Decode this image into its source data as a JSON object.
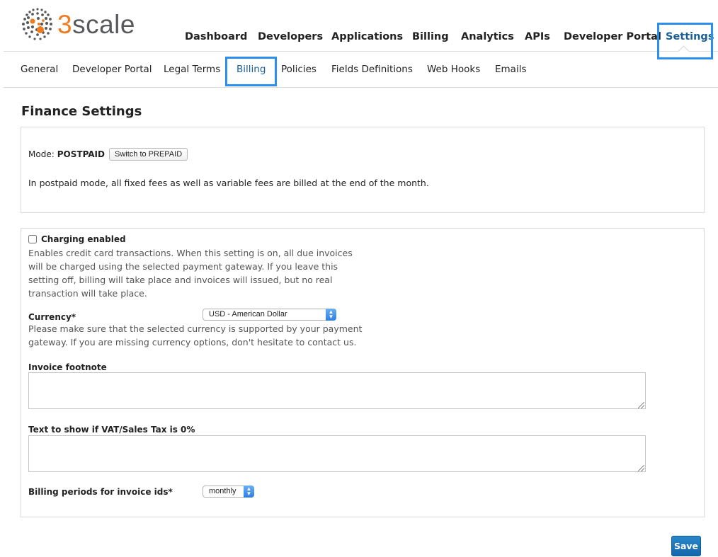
{
  "brand": {
    "logo_digit": "3",
    "logo_text": "scale",
    "accent_color": "#f07b1d",
    "highlight_color": "#2b8ff0"
  },
  "main_nav": {
    "items": [
      {
        "label": "Dashboard",
        "active": false
      },
      {
        "label": "Developers",
        "active": false
      },
      {
        "label": "Applications",
        "active": false
      },
      {
        "label": "Billing",
        "active": false
      },
      {
        "label": "Analytics",
        "active": false
      },
      {
        "label": "APIs",
        "active": false
      },
      {
        "label": "Developer Portal",
        "active": false
      },
      {
        "label": "Settings",
        "active": true
      }
    ]
  },
  "sub_nav": {
    "items": [
      {
        "label": "General",
        "active": false
      },
      {
        "label": "Developer Portal",
        "active": false
      },
      {
        "label": "Legal Terms",
        "active": false
      },
      {
        "label": "Billing",
        "active": true
      },
      {
        "label": "Policies",
        "active": false
      },
      {
        "label": "Fields Definitions",
        "active": false
      },
      {
        "label": "Web Hooks",
        "active": false
      },
      {
        "label": "Emails",
        "active": false
      }
    ]
  },
  "page": {
    "title": "Finance Settings"
  },
  "mode_panel": {
    "mode_label": "Mode:",
    "mode_value": "POSTPAID",
    "switch_button": "Switch to PREPAID",
    "description": "In postpaid mode, all fixed fees as well as variable fees are billed at the end of the month."
  },
  "form": {
    "charging": {
      "label": "Charging enabled",
      "checked": false,
      "hint": "Enables credit card transactions. When this setting is on, all due invoices will be charged using the selected payment gateway. If you leave this setting off, billing will take place and invoices will issued, but no real transaction will take place."
    },
    "currency": {
      "label": "Currency*",
      "selected": "USD - American Dollar",
      "hint": "Please make sure that the selected currency is supported by your payment gateway. If you are missing currency options, don't hesitate to contact us."
    },
    "invoice_footnote": {
      "label": "Invoice footnote",
      "value": ""
    },
    "vat_text": {
      "label": "Text to show if VAT/Sales Tax is 0%",
      "value": ""
    },
    "billing_period": {
      "label": "Billing periods for invoice ids*",
      "selected": "monthly"
    }
  },
  "actions": {
    "save_label": "Save"
  }
}
